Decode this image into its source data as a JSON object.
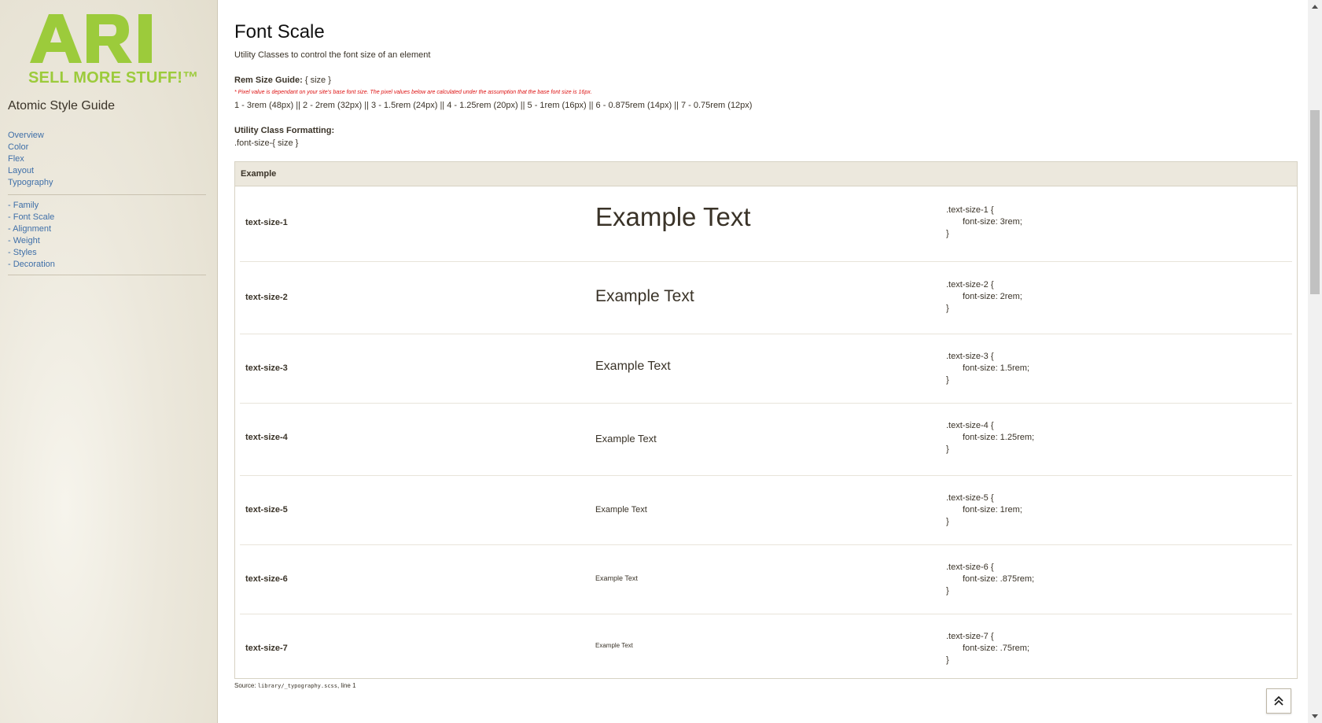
{
  "sidebar": {
    "logo_text": "ARI",
    "logo_tagline": "SELL MORE STUFF!™",
    "title": "Atomic Style Guide",
    "nav": [
      "Overview",
      "Color",
      "Flex",
      "Layout",
      "Typography"
    ],
    "subnav": [
      "- Family",
      "- Font Scale",
      "- Alignment",
      "- Weight",
      "- Styles",
      "- Decoration"
    ]
  },
  "main": {
    "title": "Font Scale",
    "subtitle": "Utility Classes to control the font size of an element",
    "rem_label": "Rem Size Guide:",
    "rem_label_value": "{ size }",
    "rem_note": "* Pixel value is dependant on your site's base font size. The pixel values below are calculated under the assumption that the base font size is 16px.",
    "rem_values": "1 - 3rem (48px) || 2 - 2rem (32px) || 3 - 1.5rem (24px) || 4 - 1.25rem (20px) || 5 - 1rem (16px) || 6 - 0.875rem (14px) || 7 - 0.75rem (12px)",
    "format_label": "Utility Class Formatting:",
    "format_value": ".font-size-{ size }",
    "table_header": "Example",
    "example_text": "Example Text",
    "rows": [
      {
        "cls": "text-size-1",
        "code_open": ".text-size-1 {",
        "code_rule": "font-size: 3rem;",
        "code_close": "}"
      },
      {
        "cls": "text-size-2",
        "code_open": ".text-size-2 {",
        "code_rule": "font-size: 2rem;",
        "code_close": "}"
      },
      {
        "cls": "text-size-3",
        "code_open": ".text-size-3 {",
        "code_rule": "font-size: 1.5rem;",
        "code_close": "}"
      },
      {
        "cls": "text-size-4",
        "code_open": ".text-size-4 {",
        "code_rule": "font-size: 1.25rem;",
        "code_close": "}"
      },
      {
        "cls": "text-size-5",
        "code_open": ".text-size-5 {",
        "code_rule": "font-size: 1rem;",
        "code_close": "}"
      },
      {
        "cls": "text-size-6",
        "code_open": ".text-size-6 {",
        "code_rule": "font-size: .875rem;",
        "code_close": "}"
      },
      {
        "cls": "text-size-7",
        "code_open": ".text-size-7 {",
        "code_rule": "font-size: .75rem;",
        "code_close": "}"
      }
    ],
    "source_label": "Source:",
    "source_file": "library/_typography.scss",
    "source_line": ", line 1"
  },
  "colors": {
    "logo_green": "#9ccb3b",
    "link_blue": "#3f6fa8",
    "note_red": "#dd1111"
  }
}
